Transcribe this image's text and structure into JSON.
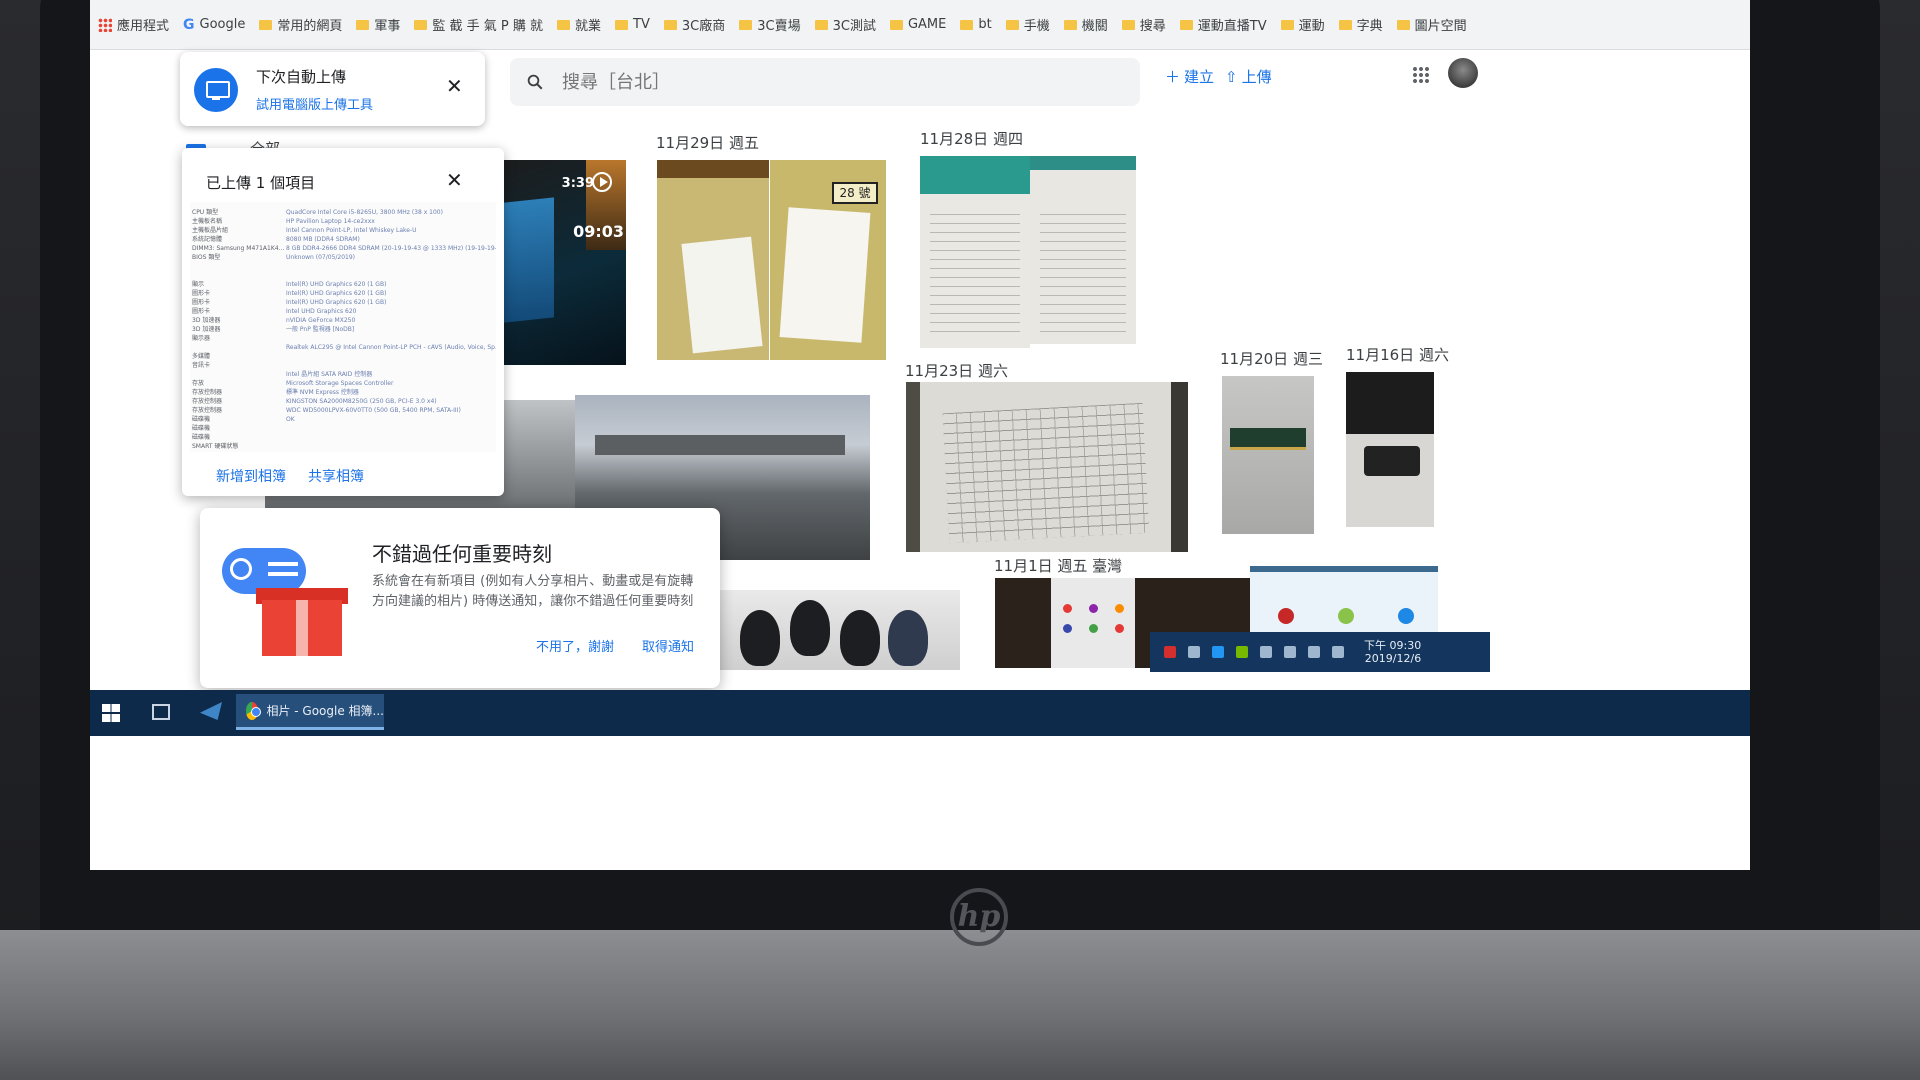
{
  "bookmarks": [
    {
      "label": "應用程式",
      "type": "apps"
    },
    {
      "label": "Google",
      "type": "google"
    },
    {
      "label": "常用的網頁",
      "type": "folder"
    },
    {
      "label": "軍事",
      "type": "folder"
    },
    {
      "label": "監 截 手 氣 P 購 就",
      "type": "folder"
    },
    {
      "label": "就業",
      "type": "folder"
    },
    {
      "label": "TV",
      "type": "folder"
    },
    {
      "label": "3C廠商",
      "type": "folder"
    },
    {
      "label": "3C賣場",
      "type": "folder"
    },
    {
      "label": "3C測試",
      "type": "folder"
    },
    {
      "label": "GAME",
      "type": "folder"
    },
    {
      "label": "bt",
      "type": "folder"
    },
    {
      "label": "手機",
      "type": "folder"
    },
    {
      "label": "機關",
      "type": "folder"
    },
    {
      "label": "搜尋",
      "type": "folder"
    },
    {
      "label": "運動直播TV",
      "type": "folder"
    },
    {
      "label": "運動",
      "type": "folder"
    },
    {
      "label": "字典",
      "type": "folder"
    },
    {
      "label": "圖片空間",
      "type": "folder"
    }
  ],
  "header": {
    "search_placeholder": "搜尋［台北］",
    "create_label": "建立",
    "upload_label": "上傳",
    "icons": {
      "search": "search-icon",
      "apps": "apps-grid-icon",
      "avatar": "avatar"
    }
  },
  "upload_prompt": {
    "title": "下次自動上傳",
    "link": "試用電腦版上傳工具",
    "close": "✕"
  },
  "sidebar_all": "全部",
  "uploaded_panel": {
    "title": "已上傳 1 個項目",
    "close": "✕",
    "add_to_album": "新增到相簿",
    "share_album": "共享相簿",
    "spec_left": [
      "CPU 類型",
      "主機板名稱",
      "主機板晶片組",
      "系統記憶體",
      "DIMM3: Samsung M471A1K4...",
      "BIOS 類型",
      "",
      "",
      "顯示",
      "圖形卡",
      "圖形卡",
      "圖形卡",
      "3D 加速器",
      "3D 加速器",
      "顯示器",
      "",
      "多媒體",
      "音訊卡",
      "",
      "存放",
      "存放控制器",
      "存放控制器",
      "存放控制器",
      "磁碟機",
      "磁碟機",
      "磁碟機",
      "SMART 硬碟狀態"
    ],
    "spec_right": [
      "QuadCore Intel Core i5-8265U, 3800 MHz (38 x 100)",
      "HP Pavilion Laptop 14-ce2xxx",
      "Intel Cannon Point-LP, Intel Whiskey Lake-U",
      "8080 MB (DDR4 SDRAM)",
      "8 GB DDR4-2666 DDR4 SDRAM (20-19-19-43 @ 1333 MHz) (19-19-19-1...",
      "Unknown (07/05/2019)",
      "",
      "",
      "Intel(R) UHD Graphics 620 (1 GB)",
      "Intel(R) UHD Graphics 620 (1 GB)",
      "Intel(R) UHD Graphics 620 (1 GB)",
      "Intel UHD Graphics 620",
      "nVIDIA GeForce MX250",
      "一般 PnP 監視器 [NoDB]",
      "",
      "Realtek ALC295 @ Intel Cannon Point-LP PCH - cAVS (Audio, Voice, Sp...",
      "",
      "",
      "Intel 晶片組 SATA RAID 控制器",
      "Microsoft Storage Spaces Controller",
      "標準 NVM Express 控制器",
      "KINGSTON SA2000M8250G (250 GB, PCI-E 3.0 x4)",
      "WDC WD5000LPVX-60V0TT0 (500 GB, 5400 RPM, SATA-III)",
      "OK"
    ]
  },
  "dates": [
    {
      "label": "11月29日 週五",
      "pos": "d1"
    },
    {
      "label": "11月28日 週四",
      "pos": "d2"
    },
    {
      "label": "11月23日 週六",
      "pos": "d3"
    },
    {
      "label": "11月20日 週三",
      "pos": "d4"
    },
    {
      "label": "11月16日 週六",
      "pos": "d5"
    },
    {
      "label": "11月1日 週五 臺灣",
      "pos": "d6"
    }
  ],
  "video": {
    "duration": "3:39",
    "clock": "09:03"
  },
  "doc_tag": "28 號",
  "notification": {
    "title": "不錯過任何重要時刻",
    "body": "系統會在有新項目 (例如有人分享相片、動畫或是有旋轉方向建議的相片) 時傳送通知，讓你不錯過任何重要時刻",
    "dismiss": "不用了，謝謝",
    "enable": "取得通知"
  },
  "taskbar": {
    "window_label": "相片 - Google 相簿...",
    "clock_time": "下午 09:30",
    "clock_date": "2019/12/6"
  },
  "colors": {
    "accent": "#1a73e8",
    "taskbar": "#0e2a4a"
  }
}
